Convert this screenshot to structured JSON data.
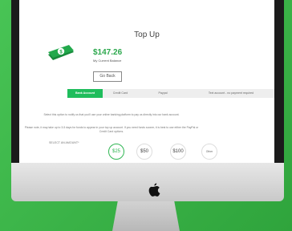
{
  "page": {
    "title": "Top Up",
    "balance_amount": "$147.26",
    "balance_label": "My Current Balance",
    "go_back_label": "Go Back"
  },
  "tabs": [
    {
      "label": "Bank Account",
      "active": true
    },
    {
      "label": "Credit Card",
      "active": false
    },
    {
      "label": "Paypal",
      "active": false
    },
    {
      "label": "Text account - no payment required",
      "active": false
    }
  ],
  "description": {
    "line1": "Select this option to notify us that you'll use your online banking platform to pay us directly into our bank account.",
    "line2": "Please note, it may take up to 3-5 days for funds to appear in your top up account. If you need funds sooner, it is best to use either the PayPal or Credit Card options."
  },
  "amounts": {
    "label": "SELECT AN AMOUNT*",
    "options": [
      {
        "label": "$25",
        "selected": true
      },
      {
        "label": "$50",
        "selected": false
      },
      {
        "label": "$100",
        "selected": false
      },
      {
        "label": "Other",
        "selected": false
      }
    ]
  },
  "colors": {
    "background": "#3db84a",
    "accent": "#1fbd5c"
  },
  "icons": {
    "money": "money-stack-icon",
    "brand": "apple-logo-icon"
  }
}
